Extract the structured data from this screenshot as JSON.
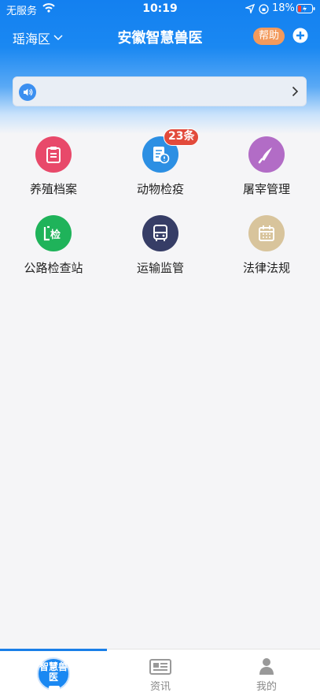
{
  "status_bar": {
    "carrier": "无服务",
    "time": "10:19",
    "battery": "18%"
  },
  "nav": {
    "region": "瑶海区",
    "title": "安徽智慧兽医",
    "help_label": "帮助"
  },
  "grid": [
    {
      "label": "养殖档案",
      "icon": "clipboard-icon",
      "color": "#e8496a"
    },
    {
      "label": "动物检疫",
      "icon": "inspection-doc-icon",
      "color": "#2c8fe3",
      "badge": "23条"
    },
    {
      "label": "屠宰管理",
      "icon": "knife-icon",
      "color": "#b26cc6"
    },
    {
      "label": "公路检查站",
      "icon": "checkpoint-icon",
      "color": "#1fb35a"
    },
    {
      "label": "运输监管",
      "icon": "bus-icon",
      "color": "#363d66"
    },
    {
      "label": "法律法规",
      "icon": "calendar-icon",
      "color": "#d8c49c"
    }
  ],
  "tabs": [
    {
      "label": "",
      "logo_text": "智慧兽医",
      "icon": "app-logo-icon",
      "active": true
    },
    {
      "label": "资讯",
      "icon": "news-icon"
    },
    {
      "label": "我的",
      "icon": "person-icon"
    }
  ],
  "colors": {
    "primary": "#1a88f2",
    "help_button": "#f39a5c",
    "badge": "#e24a3b"
  }
}
